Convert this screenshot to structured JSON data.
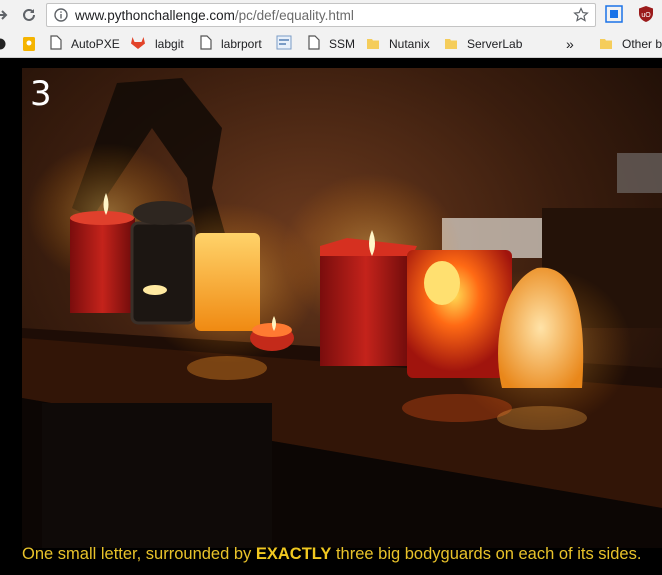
{
  "browser": {
    "url_host": "www.pythonchallenge.com",
    "url_path": "/pc/def/equality.html",
    "bookmarks": [
      {
        "label": "AutoPXE",
        "icon": "page-icon"
      },
      {
        "label": "labgit",
        "icon": "gitlab-icon"
      },
      {
        "label": "labrport",
        "icon": "page-icon"
      },
      {
        "label": "",
        "icon": "image-icon"
      },
      {
        "label": "SSM",
        "icon": "page-icon"
      },
      {
        "label": "Nutanix",
        "icon": "folder-icon"
      },
      {
        "label": "ServerLab",
        "icon": "folder-icon"
      },
      {
        "label": "Other b",
        "icon": "folder-icon"
      }
    ],
    "overflow_label": "»",
    "colors": {
      "toolbar": "#f2f2f2",
      "folder": "#f5cd5b",
      "gitlab": "#e24329"
    }
  },
  "page": {
    "level_number": "3",
    "caption_before": "One small letter, surrounded by ",
    "caption_bold": "EXACTLY",
    "caption_after": " three big bodyguards on each of its sides.",
    "caption_color": "#e8c22a"
  }
}
